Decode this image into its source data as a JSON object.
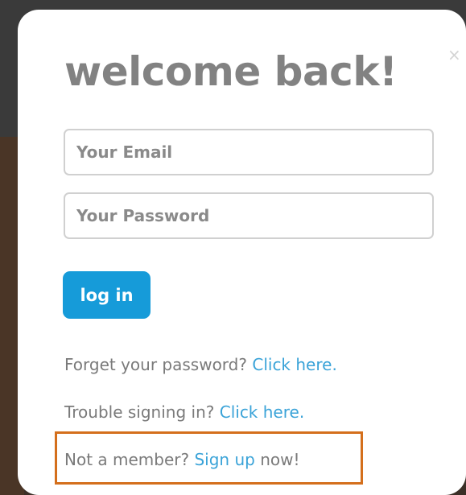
{
  "modal": {
    "title": "welcome back!",
    "close_glyph": "×",
    "close_icon": "close-icon"
  },
  "form": {
    "email_placeholder": "Your Email",
    "password_placeholder": "Your Password",
    "login_label": "log in"
  },
  "links": {
    "forgot_prefix": "Forget your password?",
    "forgot_link": "Click here.",
    "trouble_prefix": "Trouble signing in?",
    "trouble_link": "Click here.",
    "member_prefix": "Not a member?",
    "member_link": "Sign up",
    "member_suffix": "now!"
  },
  "colors": {
    "accent": "#169bd9",
    "link": "#3aa3d8",
    "highlight_border": "#d46f1c",
    "title_text": "#828282"
  }
}
